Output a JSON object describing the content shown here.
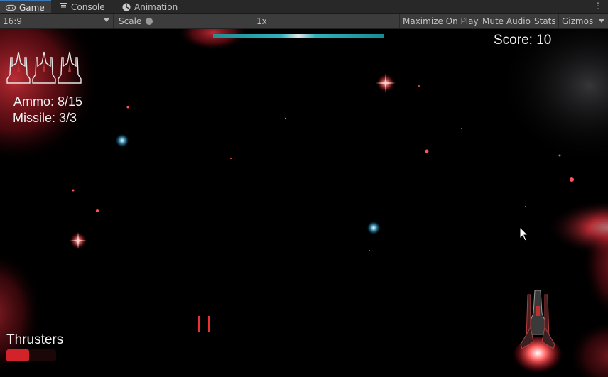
{
  "editor": {
    "tabs": [
      {
        "label": "Game",
        "icon": "gamepad-icon",
        "active": true
      },
      {
        "label": "Console",
        "icon": "console-icon",
        "active": false
      },
      {
        "label": "Animation",
        "icon": "animation-icon",
        "active": false
      }
    ],
    "menu_icon": "kebab-menu-icon",
    "toolbar": {
      "aspect": "16:9",
      "scale_label": "Scale",
      "scale_value": "1x",
      "maximize_label": "Maximize On Play",
      "mute_label": "Mute Audio",
      "stats_label": "Stats",
      "gizmos_label": "Gizmos"
    }
  },
  "hud": {
    "score": "Score: 10",
    "ammo": "Ammo: 8/15",
    "missile": "Missile: 3/3",
    "thrusters_label": "Thrusters",
    "thruster_level": 0.45,
    "lives": 3,
    "boss_health": 1.0
  },
  "colors": {
    "editor_bg": "#282828",
    "toolbar_bg": "#3c3c3c",
    "accent_tab": "#3a79bb",
    "thruster": "#d2232a",
    "laser": "#e8332f",
    "health_bar": "#35c6cf",
    "nebula": "#c0202a"
  }
}
